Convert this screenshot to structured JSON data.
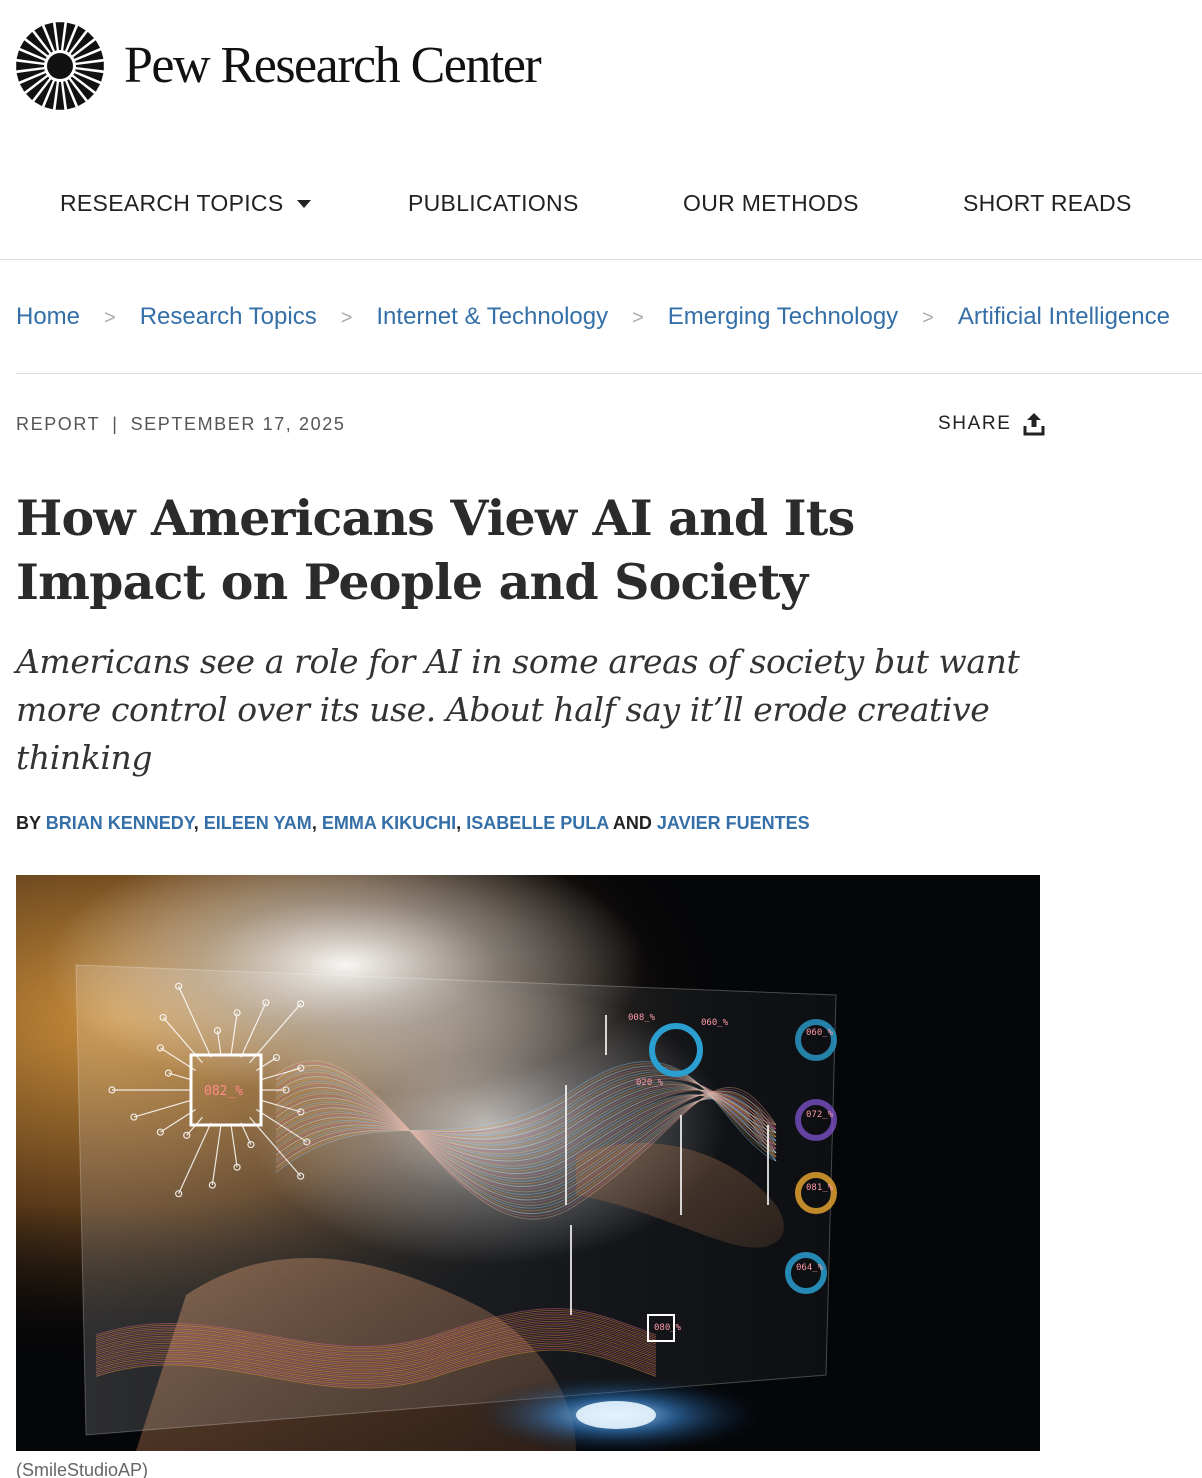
{
  "header": {
    "brand": "Pew Research Center"
  },
  "nav": {
    "items": [
      {
        "label": "RESEARCH TOPICS",
        "has_dropdown": true
      },
      {
        "label": "PUBLICATIONS"
      },
      {
        "label": "OUR METHODS"
      },
      {
        "label": "SHORT READS"
      }
    ]
  },
  "breadcrumb": [
    "Home",
    "Research Topics",
    "Internet & Technology",
    "Emerging Technology",
    "Artificial Intelligence"
  ],
  "meta": {
    "type": "REPORT",
    "date": "SEPTEMBER 17, 2025",
    "share_label": "SHARE"
  },
  "article": {
    "title": "How Americans View AI and Its Impact on People and Society",
    "subtitle": "Americans see a role for AI in some areas of society but want more control over its use. About half say it’ll erode creative thinking",
    "byline_prefix": "BY",
    "authors": [
      "BRIAN KENNEDY",
      "EILEEN YAM",
      "EMMA KIKUCHI",
      "ISABELLE PULA",
      "JAVIER FUENTES"
    ],
    "author_separator": ",",
    "author_last_join": "AND",
    "image_caption": "(SmileStudioAP)",
    "image_labels": [
      "082_%",
      "008_%",
      "060_%",
      "020_%",
      "060_%",
      "072_%",
      "081_%",
      "064_%",
      "080_%"
    ]
  },
  "colors": {
    "link": "#346fa8",
    "text": "#222222",
    "rule": "#dcdcdc"
  }
}
